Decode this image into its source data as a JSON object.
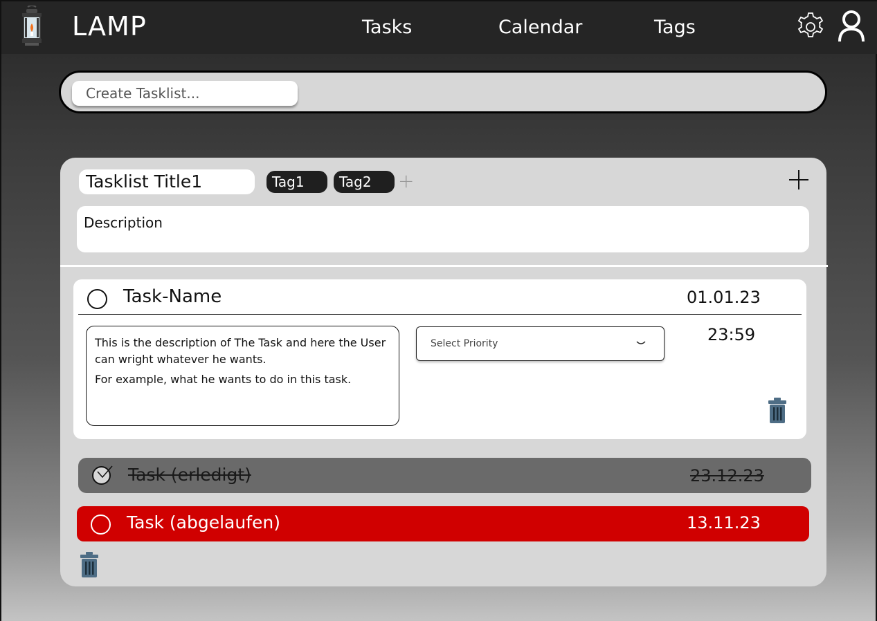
{
  "app": {
    "name": "LAMP",
    "nav": [
      {
        "label": "Tasks"
      },
      {
        "label": "Calendar"
      },
      {
        "label": "Tags"
      }
    ],
    "icons": {
      "logo": "lantern-icon",
      "settings": "gear-icon",
      "profile": "user-icon"
    }
  },
  "create_tasklist": {
    "placeholder": "Create Tasklist..."
  },
  "tasklist": {
    "title": "Tasklist Title1",
    "tags": [
      "Tag1",
      "Tag2"
    ],
    "add_tag_label": "+",
    "description": "Description",
    "tasks": [
      {
        "name": "Task-Name",
        "date": "01.01.23",
        "time": "23:59",
        "description_lines": [
          "This is the description of The Task and here the User can wright whatever he wants.",
          "For example, what he wants to do in this task."
        ],
        "priority_placeholder": "Select Priority",
        "status": "open"
      },
      {
        "name": "Task (erledigt)",
        "date": "23.12.23",
        "status": "done"
      },
      {
        "name": "Task (abgelaufen)",
        "date": "13.11.23",
        "status": "expired"
      }
    ]
  },
  "colors": {
    "topbar": "#252525",
    "card": "#d7d7d7",
    "done": "#6a6a6a",
    "expired": "#d00000",
    "trash": "#4e6d85"
  }
}
